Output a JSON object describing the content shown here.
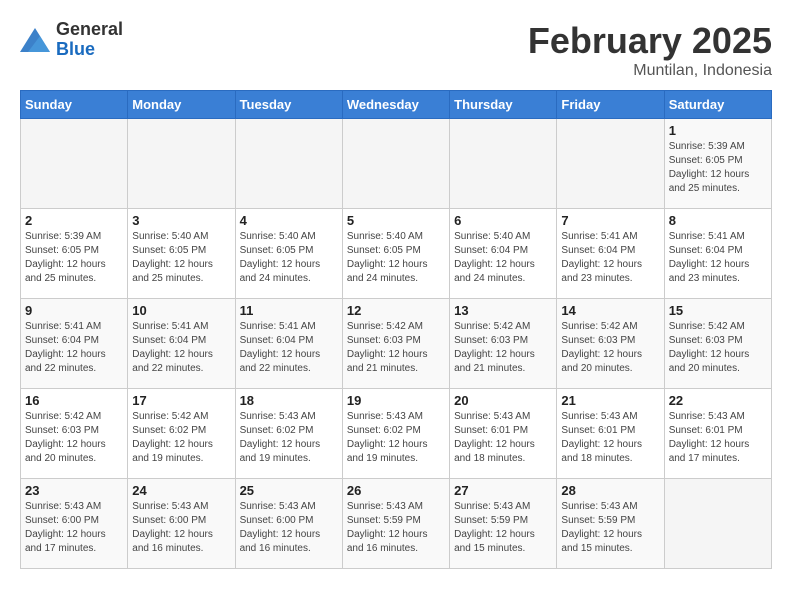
{
  "header": {
    "logo_general": "General",
    "logo_blue": "Blue",
    "month_title": "February 2025",
    "location": "Muntilan, Indonesia"
  },
  "weekdays": [
    "Sunday",
    "Monday",
    "Tuesday",
    "Wednesday",
    "Thursday",
    "Friday",
    "Saturday"
  ],
  "weeks": [
    [
      {
        "day": "",
        "info": ""
      },
      {
        "day": "",
        "info": ""
      },
      {
        "day": "",
        "info": ""
      },
      {
        "day": "",
        "info": ""
      },
      {
        "day": "",
        "info": ""
      },
      {
        "day": "",
        "info": ""
      },
      {
        "day": "1",
        "info": "Sunrise: 5:39 AM\nSunset: 6:05 PM\nDaylight: 12 hours\nand 25 minutes."
      }
    ],
    [
      {
        "day": "2",
        "info": "Sunrise: 5:39 AM\nSunset: 6:05 PM\nDaylight: 12 hours\nand 25 minutes."
      },
      {
        "day": "3",
        "info": "Sunrise: 5:40 AM\nSunset: 6:05 PM\nDaylight: 12 hours\nand 25 minutes."
      },
      {
        "day": "4",
        "info": "Sunrise: 5:40 AM\nSunset: 6:05 PM\nDaylight: 12 hours\nand 24 minutes."
      },
      {
        "day": "5",
        "info": "Sunrise: 5:40 AM\nSunset: 6:05 PM\nDaylight: 12 hours\nand 24 minutes."
      },
      {
        "day": "6",
        "info": "Sunrise: 5:40 AM\nSunset: 6:04 PM\nDaylight: 12 hours\nand 24 minutes."
      },
      {
        "day": "7",
        "info": "Sunrise: 5:41 AM\nSunset: 6:04 PM\nDaylight: 12 hours\nand 23 minutes."
      },
      {
        "day": "8",
        "info": "Sunrise: 5:41 AM\nSunset: 6:04 PM\nDaylight: 12 hours\nand 23 minutes."
      }
    ],
    [
      {
        "day": "9",
        "info": "Sunrise: 5:41 AM\nSunset: 6:04 PM\nDaylight: 12 hours\nand 22 minutes."
      },
      {
        "day": "10",
        "info": "Sunrise: 5:41 AM\nSunset: 6:04 PM\nDaylight: 12 hours\nand 22 minutes."
      },
      {
        "day": "11",
        "info": "Sunrise: 5:41 AM\nSunset: 6:04 PM\nDaylight: 12 hours\nand 22 minutes."
      },
      {
        "day": "12",
        "info": "Sunrise: 5:42 AM\nSunset: 6:03 PM\nDaylight: 12 hours\nand 21 minutes."
      },
      {
        "day": "13",
        "info": "Sunrise: 5:42 AM\nSunset: 6:03 PM\nDaylight: 12 hours\nand 21 minutes."
      },
      {
        "day": "14",
        "info": "Sunrise: 5:42 AM\nSunset: 6:03 PM\nDaylight: 12 hours\nand 20 minutes."
      },
      {
        "day": "15",
        "info": "Sunrise: 5:42 AM\nSunset: 6:03 PM\nDaylight: 12 hours\nand 20 minutes."
      }
    ],
    [
      {
        "day": "16",
        "info": "Sunrise: 5:42 AM\nSunset: 6:03 PM\nDaylight: 12 hours\nand 20 minutes."
      },
      {
        "day": "17",
        "info": "Sunrise: 5:42 AM\nSunset: 6:02 PM\nDaylight: 12 hours\nand 19 minutes."
      },
      {
        "day": "18",
        "info": "Sunrise: 5:43 AM\nSunset: 6:02 PM\nDaylight: 12 hours\nand 19 minutes."
      },
      {
        "day": "19",
        "info": "Sunrise: 5:43 AM\nSunset: 6:02 PM\nDaylight: 12 hours\nand 19 minutes."
      },
      {
        "day": "20",
        "info": "Sunrise: 5:43 AM\nSunset: 6:01 PM\nDaylight: 12 hours\nand 18 minutes."
      },
      {
        "day": "21",
        "info": "Sunrise: 5:43 AM\nSunset: 6:01 PM\nDaylight: 12 hours\nand 18 minutes."
      },
      {
        "day": "22",
        "info": "Sunrise: 5:43 AM\nSunset: 6:01 PM\nDaylight: 12 hours\nand 17 minutes."
      }
    ],
    [
      {
        "day": "23",
        "info": "Sunrise: 5:43 AM\nSunset: 6:00 PM\nDaylight: 12 hours\nand 17 minutes."
      },
      {
        "day": "24",
        "info": "Sunrise: 5:43 AM\nSunset: 6:00 PM\nDaylight: 12 hours\nand 16 minutes."
      },
      {
        "day": "25",
        "info": "Sunrise: 5:43 AM\nSunset: 6:00 PM\nDaylight: 12 hours\nand 16 minutes."
      },
      {
        "day": "26",
        "info": "Sunrise: 5:43 AM\nSunset: 5:59 PM\nDaylight: 12 hours\nand 16 minutes."
      },
      {
        "day": "27",
        "info": "Sunrise: 5:43 AM\nSunset: 5:59 PM\nDaylight: 12 hours\nand 15 minutes."
      },
      {
        "day": "28",
        "info": "Sunrise: 5:43 AM\nSunset: 5:59 PM\nDaylight: 12 hours\nand 15 minutes."
      },
      {
        "day": "",
        "info": ""
      }
    ]
  ]
}
